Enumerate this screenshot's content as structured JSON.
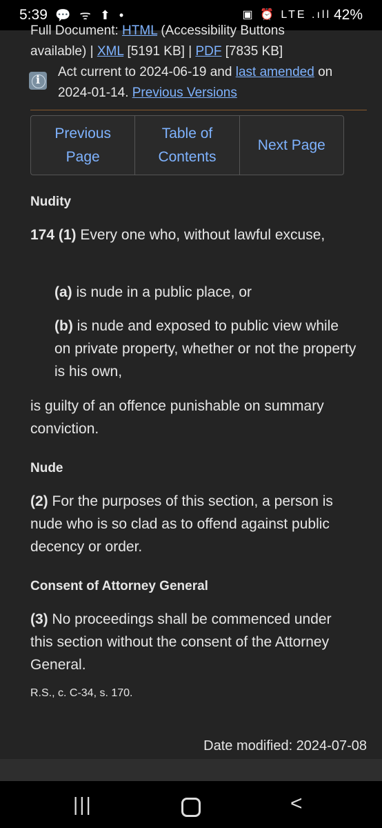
{
  "status_bar": {
    "time": "5:39",
    "left_icons": "💬 ᯤ ⬆ •",
    "right_icons": "▣ ⏰ LTE .ıll",
    "battery": "42%"
  },
  "document_links": {
    "full_document_prefix": "Full Document: ",
    "html_link": "HTML",
    "html_suffix": " (Accessibility Buttons",
    "line2_prefix": "available) | ",
    "xml_link": "XML",
    "xml_size": " [5191 KB] | ",
    "pdf_link": "PDF",
    "pdf_size": " [7835 KB]"
  },
  "currency": {
    "text1": "Act current to 2024-06-19 and ",
    "last_amended_link": "last amended",
    "text2": " on",
    "date": "2024-01-14. ",
    "previous_versions_link": "Previous Versions"
  },
  "pager": {
    "previous_line1": "Previous",
    "previous_line2": "Page",
    "toc_line1": "Table of",
    "toc_line2": "Contents",
    "next": "Next Page"
  },
  "section": {
    "heading1": "Nudity",
    "s1_label": "174 (1)",
    "s1_text": " Every one who, without lawful excuse,",
    "a_label": "(a)",
    "a_text": " is nude in a public place, or",
    "b_label": "(b)",
    "b_text": " is nude and exposed to public view while on private property, whether or not the property is his own,",
    "s1_conclusion": "is guilty of an offence punishable on summary conviction.",
    "heading2": "Nude",
    "s2_label": "(2)",
    "s2_text": " For the purposes of this section, a person is nude who is so clad as to offend against public decency or order.",
    "heading3": "Consent of Attorney General",
    "s3_label": "(3)",
    "s3_text": " No proceedings shall be commenced under this section without the consent of the Attorney General.",
    "history": "R.S., c. C-34, s. 170."
  },
  "footer": {
    "date_modified": "Date modified: 2024-07-08"
  },
  "navbar": {
    "recents": "|||",
    "back": "<"
  }
}
